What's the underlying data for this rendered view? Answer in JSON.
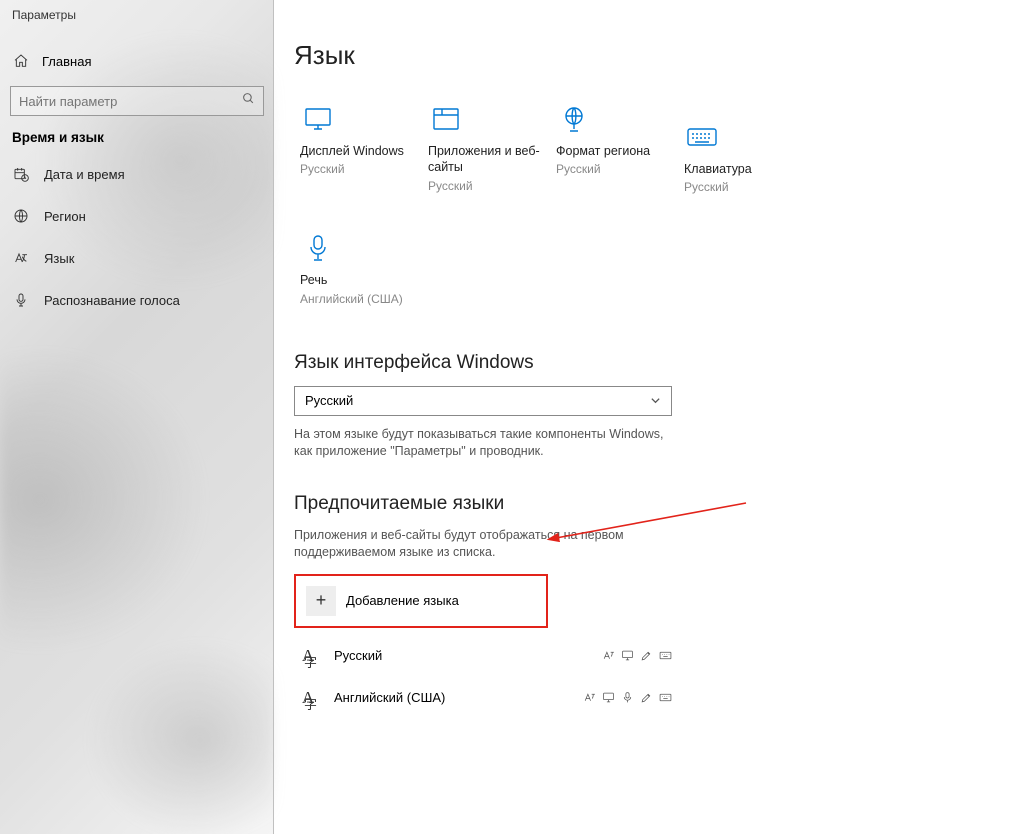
{
  "window_title": "Параметры",
  "sidebar": {
    "home": "Главная",
    "search_placeholder": "Найти параметр",
    "section": "Время и язык",
    "items": [
      {
        "label": "Дата и время"
      },
      {
        "label": "Регион"
      },
      {
        "label": "Язык"
      },
      {
        "label": "Распознавание голоса"
      }
    ]
  },
  "main": {
    "title": "Язык",
    "tiles": [
      {
        "title": "Дисплей Windows",
        "sub": "Русский"
      },
      {
        "title": "Приложения и веб-сайты",
        "sub": "Русский"
      },
      {
        "title": "Формат региона",
        "sub": "Русский"
      },
      {
        "title": "Клавиатура",
        "sub": "Русский"
      },
      {
        "title": "Речь",
        "sub": "Английский (США)"
      }
    ],
    "section_display": "Язык интерфейса Windows",
    "display_select": "Русский",
    "display_helper": "На этом языке будут показываться такие компоненты Windows, как приложение \"Параметры\" и проводник.",
    "section_preferred": "Предпочитаемые языки",
    "preferred_helper": "Приложения и веб-сайты будут отображаться на первом поддерживаемом языке из списка.",
    "add_language": "Добавление языка",
    "languages": [
      {
        "name": "Русский"
      },
      {
        "name": "Английский (США)"
      }
    ]
  }
}
